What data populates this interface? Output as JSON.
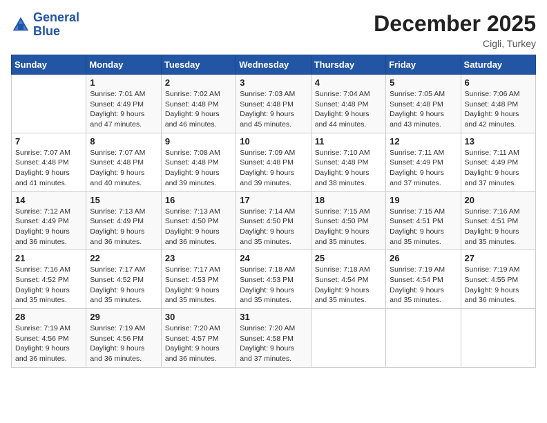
{
  "logo": {
    "line1": "General",
    "line2": "Blue"
  },
  "title": "December 2025",
  "location": "Cigli, Turkey",
  "days_of_week": [
    "Sunday",
    "Monday",
    "Tuesday",
    "Wednesday",
    "Thursday",
    "Friday",
    "Saturday"
  ],
  "weeks": [
    [
      {
        "day": "",
        "sunrise": "",
        "sunset": "",
        "daylight": ""
      },
      {
        "day": "1",
        "sunrise": "Sunrise: 7:01 AM",
        "sunset": "Sunset: 4:49 PM",
        "daylight": "Daylight: 9 hours and 47 minutes."
      },
      {
        "day": "2",
        "sunrise": "Sunrise: 7:02 AM",
        "sunset": "Sunset: 4:48 PM",
        "daylight": "Daylight: 9 hours and 46 minutes."
      },
      {
        "day": "3",
        "sunrise": "Sunrise: 7:03 AM",
        "sunset": "Sunset: 4:48 PM",
        "daylight": "Daylight: 9 hours and 45 minutes."
      },
      {
        "day": "4",
        "sunrise": "Sunrise: 7:04 AM",
        "sunset": "Sunset: 4:48 PM",
        "daylight": "Daylight: 9 hours and 44 minutes."
      },
      {
        "day": "5",
        "sunrise": "Sunrise: 7:05 AM",
        "sunset": "Sunset: 4:48 PM",
        "daylight": "Daylight: 9 hours and 43 minutes."
      },
      {
        "day": "6",
        "sunrise": "Sunrise: 7:06 AM",
        "sunset": "Sunset: 4:48 PM",
        "daylight": "Daylight: 9 hours and 42 minutes."
      }
    ],
    [
      {
        "day": "7",
        "sunrise": "Sunrise: 7:07 AM",
        "sunset": "Sunset: 4:48 PM",
        "daylight": "Daylight: 9 hours and 41 minutes."
      },
      {
        "day": "8",
        "sunrise": "Sunrise: 7:07 AM",
        "sunset": "Sunset: 4:48 PM",
        "daylight": "Daylight: 9 hours and 40 minutes."
      },
      {
        "day": "9",
        "sunrise": "Sunrise: 7:08 AM",
        "sunset": "Sunset: 4:48 PM",
        "daylight": "Daylight: 9 hours and 39 minutes."
      },
      {
        "day": "10",
        "sunrise": "Sunrise: 7:09 AM",
        "sunset": "Sunset: 4:48 PM",
        "daylight": "Daylight: 9 hours and 39 minutes."
      },
      {
        "day": "11",
        "sunrise": "Sunrise: 7:10 AM",
        "sunset": "Sunset: 4:48 PM",
        "daylight": "Daylight: 9 hours and 38 minutes."
      },
      {
        "day": "12",
        "sunrise": "Sunrise: 7:11 AM",
        "sunset": "Sunset: 4:49 PM",
        "daylight": "Daylight: 9 hours and 37 minutes."
      },
      {
        "day": "13",
        "sunrise": "Sunrise: 7:11 AM",
        "sunset": "Sunset: 4:49 PM",
        "daylight": "Daylight: 9 hours and 37 minutes."
      }
    ],
    [
      {
        "day": "14",
        "sunrise": "Sunrise: 7:12 AM",
        "sunset": "Sunset: 4:49 PM",
        "daylight": "Daylight: 9 hours and 36 minutes."
      },
      {
        "day": "15",
        "sunrise": "Sunrise: 7:13 AM",
        "sunset": "Sunset: 4:49 PM",
        "daylight": "Daylight: 9 hours and 36 minutes."
      },
      {
        "day": "16",
        "sunrise": "Sunrise: 7:13 AM",
        "sunset": "Sunset: 4:50 PM",
        "daylight": "Daylight: 9 hours and 36 minutes."
      },
      {
        "day": "17",
        "sunrise": "Sunrise: 7:14 AM",
        "sunset": "Sunset: 4:50 PM",
        "daylight": "Daylight: 9 hours and 35 minutes."
      },
      {
        "day": "18",
        "sunrise": "Sunrise: 7:15 AM",
        "sunset": "Sunset: 4:50 PM",
        "daylight": "Daylight: 9 hours and 35 minutes."
      },
      {
        "day": "19",
        "sunrise": "Sunrise: 7:15 AM",
        "sunset": "Sunset: 4:51 PM",
        "daylight": "Daylight: 9 hours and 35 minutes."
      },
      {
        "day": "20",
        "sunrise": "Sunrise: 7:16 AM",
        "sunset": "Sunset: 4:51 PM",
        "daylight": "Daylight: 9 hours and 35 minutes."
      }
    ],
    [
      {
        "day": "21",
        "sunrise": "Sunrise: 7:16 AM",
        "sunset": "Sunset: 4:52 PM",
        "daylight": "Daylight: 9 hours and 35 minutes."
      },
      {
        "day": "22",
        "sunrise": "Sunrise: 7:17 AM",
        "sunset": "Sunset: 4:52 PM",
        "daylight": "Daylight: 9 hours and 35 minutes."
      },
      {
        "day": "23",
        "sunrise": "Sunrise: 7:17 AM",
        "sunset": "Sunset: 4:53 PM",
        "daylight": "Daylight: 9 hours and 35 minutes."
      },
      {
        "day": "24",
        "sunrise": "Sunrise: 7:18 AM",
        "sunset": "Sunset: 4:53 PM",
        "daylight": "Daylight: 9 hours and 35 minutes."
      },
      {
        "day": "25",
        "sunrise": "Sunrise: 7:18 AM",
        "sunset": "Sunset: 4:54 PM",
        "daylight": "Daylight: 9 hours and 35 minutes."
      },
      {
        "day": "26",
        "sunrise": "Sunrise: 7:19 AM",
        "sunset": "Sunset: 4:54 PM",
        "daylight": "Daylight: 9 hours and 35 minutes."
      },
      {
        "day": "27",
        "sunrise": "Sunrise: 7:19 AM",
        "sunset": "Sunset: 4:55 PM",
        "daylight": "Daylight: 9 hours and 36 minutes."
      }
    ],
    [
      {
        "day": "28",
        "sunrise": "Sunrise: 7:19 AM",
        "sunset": "Sunset: 4:56 PM",
        "daylight": "Daylight: 9 hours and 36 minutes."
      },
      {
        "day": "29",
        "sunrise": "Sunrise: 7:19 AM",
        "sunset": "Sunset: 4:56 PM",
        "daylight": "Daylight: 9 hours and 36 minutes."
      },
      {
        "day": "30",
        "sunrise": "Sunrise: 7:20 AM",
        "sunset": "Sunset: 4:57 PM",
        "daylight": "Daylight: 9 hours and 36 minutes."
      },
      {
        "day": "31",
        "sunrise": "Sunrise: 7:20 AM",
        "sunset": "Sunset: 4:58 PM",
        "daylight": "Daylight: 9 hours and 37 minutes."
      },
      {
        "day": "",
        "sunrise": "",
        "sunset": "",
        "daylight": ""
      },
      {
        "day": "",
        "sunrise": "",
        "sunset": "",
        "daylight": ""
      },
      {
        "day": "",
        "sunrise": "",
        "sunset": "",
        "daylight": ""
      }
    ]
  ]
}
